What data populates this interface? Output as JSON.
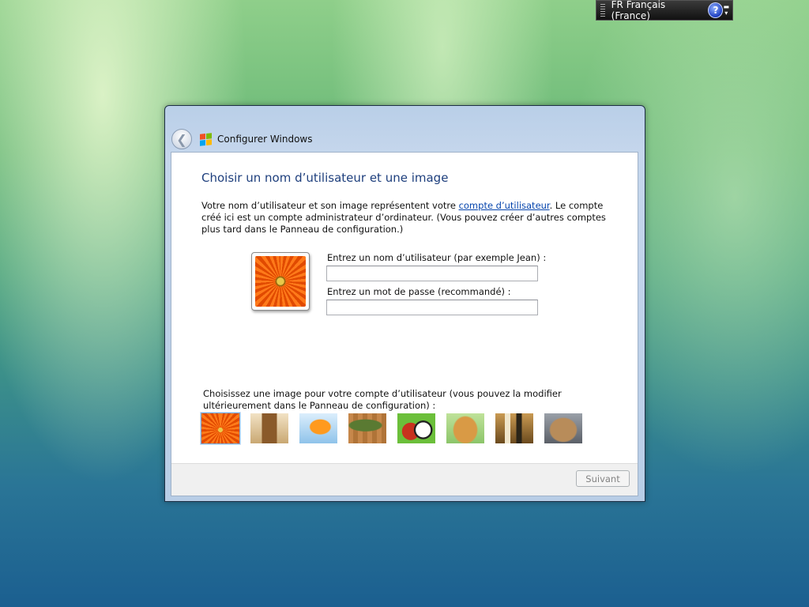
{
  "language_bar": {
    "language": "FR Français (France)",
    "help_symbol": "?",
    "options_symbol": "▬",
    "options_arrow": "▾"
  },
  "window": {
    "title": "Configurer Windows",
    "back_symbol": "❮"
  },
  "page": {
    "heading": "Choisir un nom d’utilisateur et une image",
    "intro_before_link": "Votre nom d’utilisateur et son image représentent votre ",
    "intro_link": "compte d’utilisateur",
    "intro_after_link": ". Le compte créé ici est un compte administrateur d’ordinateur. (Vous pouvez créer d’autres comptes plus tard dans le Panneau de configuration.)",
    "username_label": "Entrez un nom d’utilisateur (par exemple Jean) :",
    "username_value": "",
    "password_label": "Entrez un mot de passe (recommandé) :",
    "password_value": "",
    "choose_picture_text": "Choisissez une image pour votre compte d’utilisateur (vous pouvez la modifier ultérieurement dans le Panneau de configuration) :",
    "pictures": [
      "flower",
      "robot",
      "goldfish",
      "bonsai",
      "balls",
      "dog",
      "chess",
      "kitten"
    ],
    "selected_picture": "flower"
  },
  "footer": {
    "next_label": "Suivant"
  },
  "colors": {
    "heading": "#1e3f7d",
    "link": "#0645ad",
    "window_frame": "#b9cfe8",
    "logo": [
      "#f25022",
      "#7fba00",
      "#00a4ef",
      "#ffb900"
    ]
  }
}
